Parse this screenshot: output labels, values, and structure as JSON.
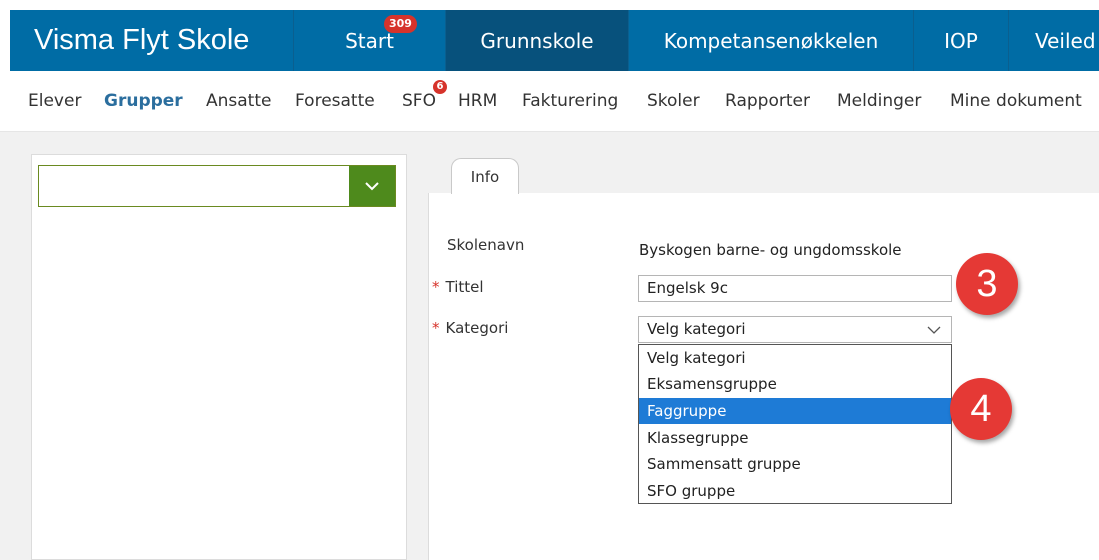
{
  "app": {
    "title": "Visma Flyt Skole"
  },
  "topnav": [
    {
      "label": "Start",
      "badge": "309"
    },
    {
      "label": "Grunnskole",
      "active": true
    },
    {
      "label": "Kompetansenøkkelen"
    },
    {
      "label": "IOP"
    },
    {
      "label": "Veiled"
    }
  ],
  "subnav": {
    "items": [
      "Elever",
      "Grupper",
      "Ansatte",
      "Foresatte",
      "SFO",
      "HRM",
      "Fakturering",
      "Skoler",
      "Rapporter",
      "Meldinger",
      "Mine dokument"
    ],
    "active": "Grupper",
    "sfo_badge": "6"
  },
  "left_panel": {
    "selected_value": ""
  },
  "form": {
    "tab_label": "Info",
    "school_label": "Skolenavn",
    "school_value": "Byskogen barne- og ungdomsskole",
    "title_label": "Tittel",
    "title_value": "Engelsk 9c",
    "category_label": "Kategori",
    "category_selected": "Velg kategori",
    "required_marker": "*",
    "category_options": [
      "Velg kategori",
      "Eksamensgruppe",
      "Faggruppe",
      "Klassegruppe",
      "Sammensatt gruppe",
      "SFO gruppe"
    ],
    "highlighted_option": "Faggruppe"
  },
  "annotations": {
    "marker_3": "3",
    "marker_4": "4"
  },
  "colors": {
    "header": "#006ca5",
    "header_active": "#07517c",
    "badge": "#d6332b",
    "select_button": "#4e8a1c",
    "highlight": "#1e7bd6",
    "marker": "#e53935"
  }
}
